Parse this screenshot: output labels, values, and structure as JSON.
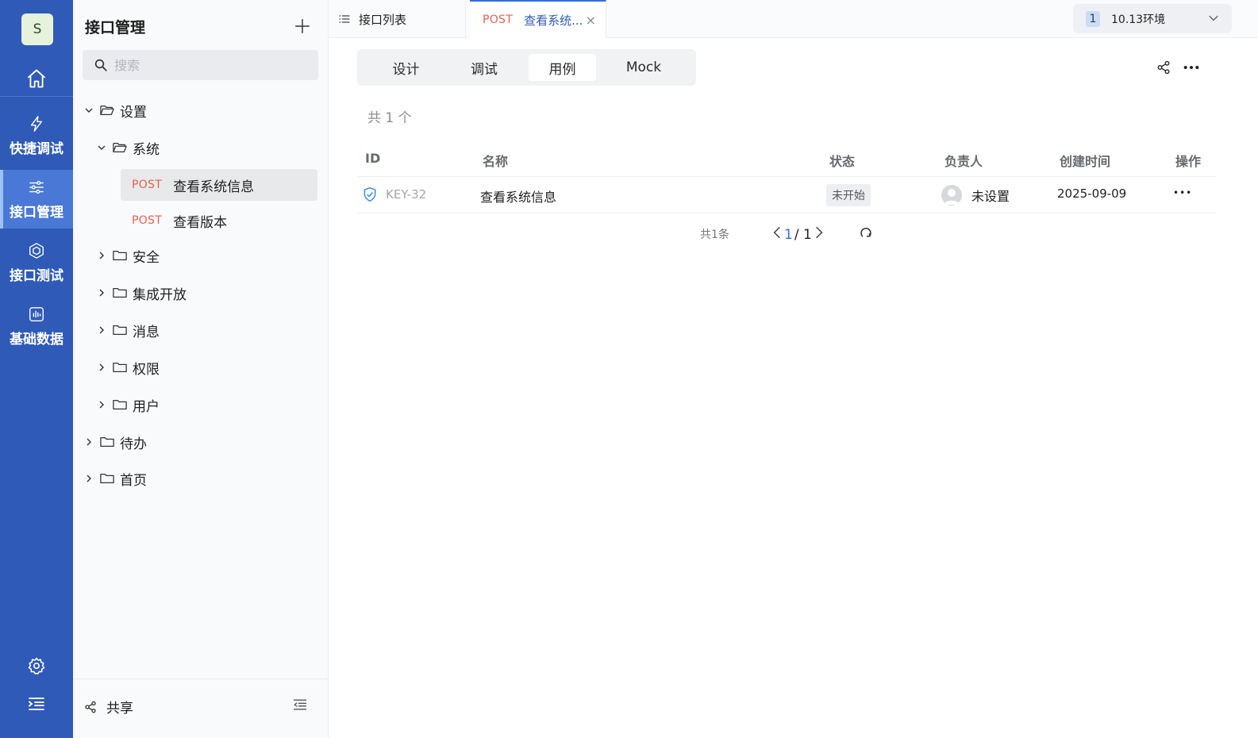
{
  "rail": {
    "avatar_letter": "S",
    "items": [
      {
        "label": "快捷调试",
        "icon": "lightning-icon"
      },
      {
        "label": "接口管理",
        "icon": "sliders-icon",
        "active": true
      },
      {
        "label": "接口测试",
        "icon": "cube-icon"
      },
      {
        "label": "基础数据",
        "icon": "chart-icon"
      }
    ]
  },
  "sidebar": {
    "title": "接口管理",
    "search_placeholder": "搜索",
    "tree": {
      "settings": "设置",
      "system": "系统",
      "api_1_method": "POST",
      "api_1_name": "查看系统信息",
      "api_2_method": "POST",
      "api_2_name": "查看版本",
      "security": "安全",
      "integration": "集成开放",
      "message": "消息",
      "permission": "权限",
      "user": "用户",
      "todo": "待办",
      "home": "首页"
    },
    "footer_share": "共享"
  },
  "tabs": {
    "list_label": "接口列表",
    "active_method": "POST",
    "active_label": "查看系统...",
    "close": "×"
  },
  "env": {
    "badge": "1",
    "label": "10.13环境"
  },
  "segments": [
    "设计",
    "调试",
    "用例",
    "Mock"
  ],
  "active_segment": "用例",
  "count_text": "共 1 个",
  "table": {
    "headers": {
      "id": "ID",
      "name": "名称",
      "status": "状态",
      "owner": "负责人",
      "created": "创建时间",
      "ops": "操作"
    },
    "rows": [
      {
        "id": "KEY-32",
        "name": "查看系统信息",
        "status": "未开始",
        "owner": "未设置",
        "created": "2025-09-09",
        "ops": "•••"
      }
    ]
  },
  "pager": {
    "total": "共1条",
    "current": "1",
    "pages": "/ 1"
  },
  "colors": {
    "rail": "#2f5ab8",
    "accent": "#2f6fe0",
    "method_post": "#e8614c"
  }
}
